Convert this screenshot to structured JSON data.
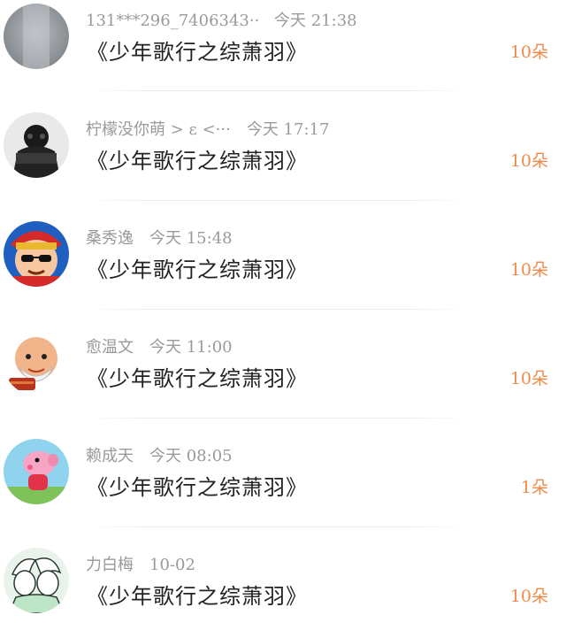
{
  "gift_list": {
    "items": [
      {
        "name": "131***296_7406343···",
        "time": "今天 21:38",
        "gift": "《少年歌行之综萧羽》",
        "count": "10朵"
      },
      {
        "name": "柠檬没你萌 > ε <···",
        "time": "今天 17:17",
        "gift": "《少年歌行之综萧羽》",
        "count": "10朵"
      },
      {
        "name": "桑秀逸",
        "time": "今天 15:48",
        "gift": "《少年歌行之综萧羽》",
        "count": "10朵"
      },
      {
        "name": "愈温文",
        "time": "今天 11:00",
        "gift": "《少年歌行之综萧羽》",
        "count": "10朵"
      },
      {
        "name": "赖成天",
        "time": "今天 08:05",
        "gift": "《少年歌行之综萧羽》",
        "count": "1朵"
      },
      {
        "name": "力白梅",
        "time": "10-02",
        "gift": "《少年歌行之综萧羽》",
        "count": "10朵"
      }
    ]
  },
  "colors": {
    "count_accent": "#ef8a4a",
    "meta_gray": "#9a9a9a",
    "text_dark": "#222222"
  }
}
